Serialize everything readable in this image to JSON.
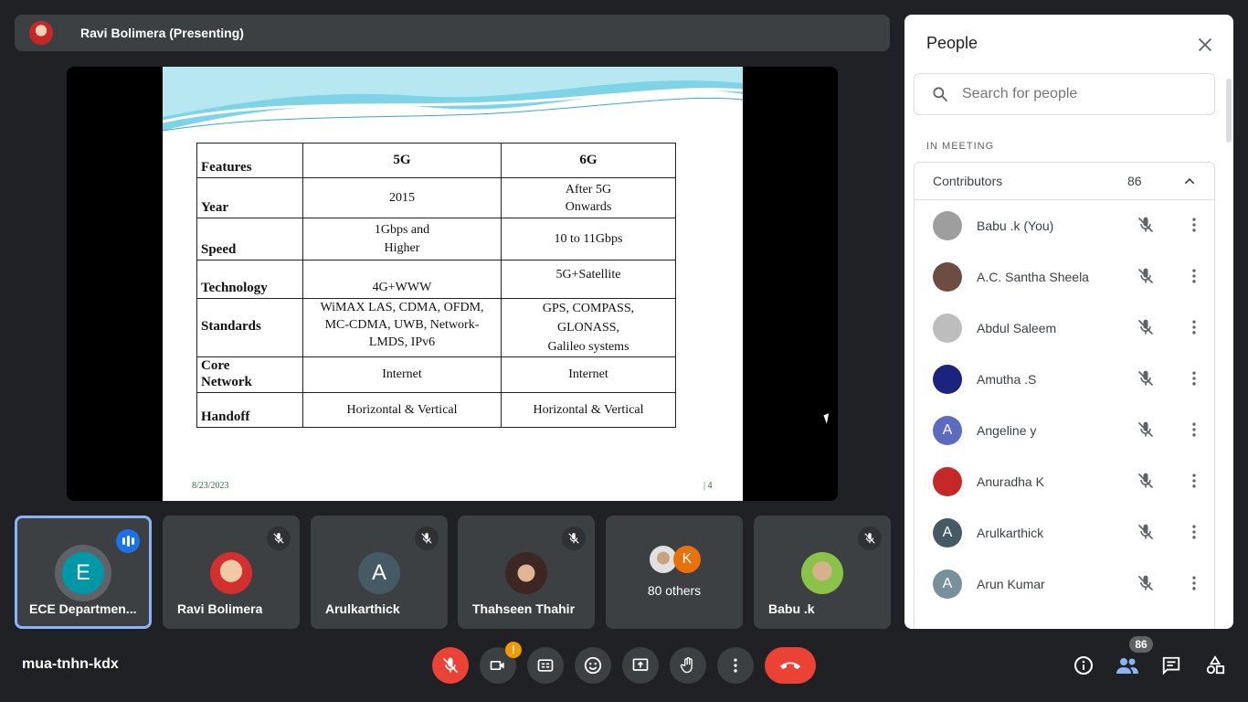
{
  "presenter": {
    "name": "Ravi Bolimera (Presenting)"
  },
  "slide": {
    "headers": [
      "Features",
      "5G",
      "6G"
    ],
    "rows": [
      {
        "feature": "Year",
        "g5": "2015",
        "g6": "After 5G\nOnwards"
      },
      {
        "feature": "Speed",
        "g5": "1Gbps and\nHigher",
        "g6": "10 to 11Gbps"
      },
      {
        "feature": "Technology",
        "g5": "4G+WWW",
        "g6": "5G+Satellite"
      },
      {
        "feature": "Standards",
        "g5": "WiMAX LAS, CDMA, OFDM,\nMC-CDMA, UWB, Network-\nLMDS, IPv6",
        "g6": "GPS, COMPASS,\nGLONASS,\nGalileo systems"
      },
      {
        "feature": "Core\nNetwork",
        "g5": "Internet",
        "g6": "Internet"
      },
      {
        "feature": "Handoff",
        "g5": "Horizontal & Vertical",
        "g6": "Horizontal & Vertical"
      }
    ],
    "date": "8/23/2023",
    "page": "| 4"
  },
  "tiles": [
    {
      "name": "ECE Departmen...",
      "initial": "E",
      "color": "#0097a7"
    },
    {
      "name": "Ravi Bolimera",
      "initial": "",
      "color": "#d32f2f"
    },
    {
      "name": "Arulkarthick",
      "initial": "A",
      "color": "#455a64"
    },
    {
      "name": "Thahseen Thahir",
      "initial": "",
      "color": "#8d6e63"
    },
    {
      "name": "80 others",
      "initial": "K",
      "color": "#e8710a"
    },
    {
      "name": "Babu .k",
      "initial": "",
      "color": "#9e9e9e"
    }
  ],
  "meeting_code": "mua-tnhn-kdx",
  "controls": {
    "camera_alert": "!"
  },
  "participants_count": "86",
  "panel": {
    "title": "People",
    "search_placeholder": "Search for people",
    "in_meeting": "IN MEETING",
    "section_label": "Contributors",
    "section_count": "86",
    "people": [
      {
        "name": "Babu .k (You)",
        "initial": "",
        "color": "#9e9e9e"
      },
      {
        "name": "A.C. Santha Sheela",
        "initial": "",
        "color": "#6d4c41"
      },
      {
        "name": "Abdul Saleem",
        "initial": "",
        "color": "#bdbdbd"
      },
      {
        "name": "Amutha .S",
        "initial": "",
        "color": "#1a237e"
      },
      {
        "name": "Angeline y",
        "initial": "A",
        "color": "#5c6bc0"
      },
      {
        "name": "Anuradha K",
        "initial": "",
        "color": "#c62828"
      },
      {
        "name": "Arulkarthick",
        "initial": "A",
        "color": "#455a64"
      },
      {
        "name": "Arun Kumar",
        "initial": "A",
        "color": "#78909c"
      }
    ]
  }
}
